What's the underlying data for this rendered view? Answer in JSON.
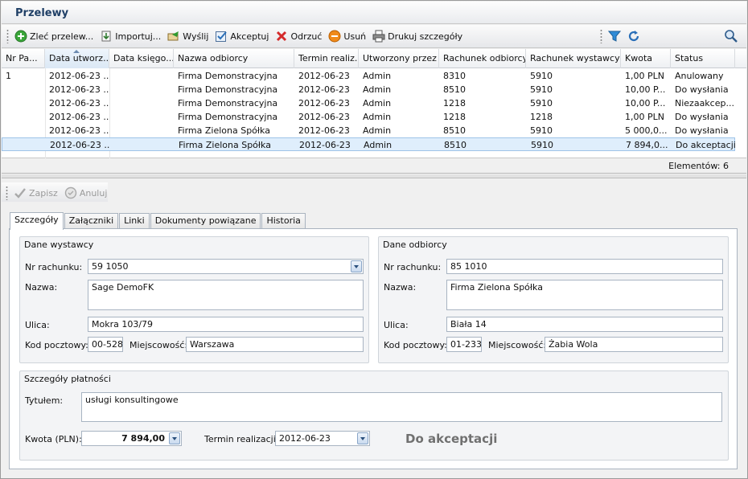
{
  "app": {
    "title": "Przelewy"
  },
  "toolbar": {
    "items": [
      {
        "label": "Zleć przelew...",
        "icon": "add-green-icon"
      },
      {
        "label": "Importuj...",
        "icon": "import-icon"
      },
      {
        "label": "Wyślij",
        "icon": "send-icon"
      },
      {
        "label": "Akceptuj",
        "icon": "accept-icon"
      },
      {
        "label": "Odrzuć",
        "icon": "reject-icon"
      },
      {
        "label": "Usuń",
        "icon": "delete-icon"
      },
      {
        "label": "Drukuj szczegóły",
        "icon": "print-icon"
      }
    ],
    "filter_icon": "filter-icon",
    "refresh_icon": "refresh-icon",
    "search_icon": "search-icon"
  },
  "grid": {
    "columns": [
      "Nr Pa...",
      "Data utworz...",
      "Data księgo...",
      "Nazwa odbiorcy",
      "Termin realiz...",
      "Utworzony przez",
      "Rachunek odbiorcy",
      "Rachunek wystawcy",
      "Kwota",
      "Status"
    ],
    "rows": [
      [
        "1",
        "2012-06-23 ...",
        "",
        "Firma Demonstracyjna",
        "2012-06-23",
        "Admin",
        "8310",
        "5910",
        "1,00 PLN",
        "Anulowany"
      ],
      [
        "",
        "2012-06-23 ...",
        "",
        "Firma Demonstracyjna",
        "2012-06-23",
        "Admin",
        "8510",
        "5910",
        "10,00 P...",
        "Do wysłania"
      ],
      [
        "",
        "2012-06-23 ...",
        "",
        "Firma Demonstracyjna",
        "2012-06-23",
        "Admin",
        "1218",
        "5910",
        "10,00 P...",
        "Niezaakcep..."
      ],
      [
        "",
        "2012-06-23 ...",
        "",
        "Firma Demonstracyjna",
        "2012-06-23",
        "Admin",
        "1218",
        "1218",
        "1,00 PLN",
        "Do wysłania"
      ],
      [
        "",
        "2012-06-23 ...",
        "",
        "Firma Zielona Spółka",
        "2012-06-23",
        "Admin",
        "8510",
        "5910",
        "5 000,0...",
        "Do wysłania"
      ],
      [
        "",
        "2012-06-23 ...",
        "",
        "Firma Zielona Spółka",
        "2012-06-23",
        "Admin",
        "8510",
        "5910",
        "7 894,0...",
        "Do akceptacji"
      ]
    ],
    "footer": "Elementów: 6"
  },
  "detail_toolbar": {
    "save_label": "Zapisz",
    "cancel_label": "Anuluj"
  },
  "tabs": [
    "Szczegóły",
    "Załączniki",
    "Linki",
    "Dokumenty powiązane",
    "Historia"
  ],
  "issuer": {
    "title": "Dane wystawcy",
    "account_label": "Nr rachunku:",
    "account": "59 1050",
    "name_label": "Nazwa:",
    "name": "Sage DemoFK",
    "street_label": "Ulica:",
    "street": "Mokra 103/79",
    "postcode_label": "Kod pocztowy:",
    "postcode": "00-528",
    "city_label": "Miejscowość:",
    "city": "Warszawa"
  },
  "recipient": {
    "title": "Dane odbiorcy",
    "account_label": "Nr rachunku:",
    "account": "85 1010",
    "name_label": "Nazwa:",
    "name": "Firma Zielona Spółka",
    "street_label": "Ulica:",
    "street": "Biała 14",
    "postcode_label": "Kod pocztowy:",
    "postcode": "01-233",
    "city_label": "Miejscowość:",
    "city": "Żabia Wola"
  },
  "payment": {
    "title": "Szczegóły płatności",
    "title_label": "Tytułem:",
    "title_value": "usługi konsultingowe",
    "amount_label": "Kwota (PLN):",
    "amount": "7 894,00",
    "due_label": "Termin realizacji:",
    "due": "2012-06-23",
    "status": "Do akceptacji"
  }
}
